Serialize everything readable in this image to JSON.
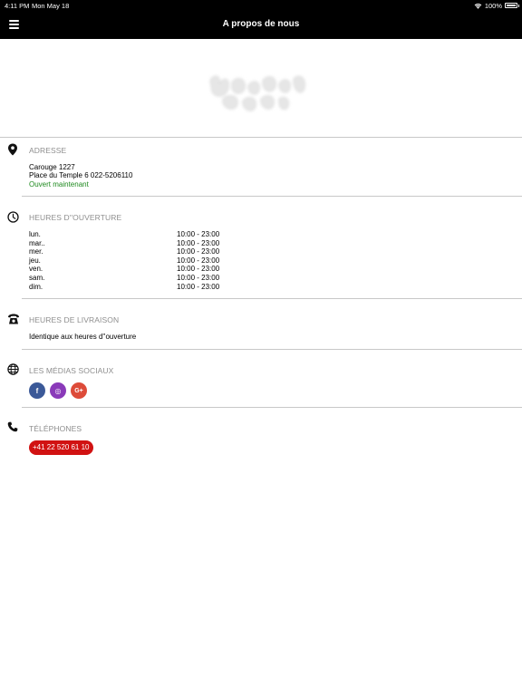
{
  "status_bar": {
    "time": "4:11 PM",
    "date": "Mon May 18",
    "battery": "100%"
  },
  "nav": {
    "title": "A propos de nous",
    "menu_icon": "hamburger-icon"
  },
  "logo": {
    "alt": "Wasabi"
  },
  "address": {
    "heading": "ADRESSE",
    "line1": "Carouge 1227",
    "line2": "Place du Temple 6 022-5206110",
    "status": "Ouvert maintenant",
    "status_color": "#1f8a1f"
  },
  "opening_hours": {
    "heading": "HEURES D''OUVERTURE",
    "rows": [
      {
        "day": "lun.",
        "hours": "10:00 - 23:00"
      },
      {
        "day": "mar..",
        "hours": "10:00 - 23:00"
      },
      {
        "day": "mer.",
        "hours": "10:00 - 23:00"
      },
      {
        "day": "jeu.",
        "hours": "10:00 - 23:00"
      },
      {
        "day": "ven.",
        "hours": "10:00 - 23:00"
      },
      {
        "day": "sam.",
        "hours": "10:00 - 23:00"
      },
      {
        "day": "dim.",
        "hours": "10:00 - 23:00"
      }
    ]
  },
  "delivery_hours": {
    "heading": "HEURES DE LIVRAISON",
    "text": "Identique aux heures d''ouverture"
  },
  "social": {
    "heading": "LES MÉDIAS SOCIAUX",
    "items": [
      {
        "name": "facebook-icon",
        "glyph": "f",
        "color": "#3b5998"
      },
      {
        "name": "instagram-icon",
        "glyph": "◎",
        "color": "#8a3ab9"
      },
      {
        "name": "google-plus-icon",
        "glyph": "G+",
        "color": "#dd4b39"
      }
    ]
  },
  "phones": {
    "heading": "TÉLÉPHONES",
    "number": "+41 22 520 61 10",
    "button_color": "#d11212"
  }
}
